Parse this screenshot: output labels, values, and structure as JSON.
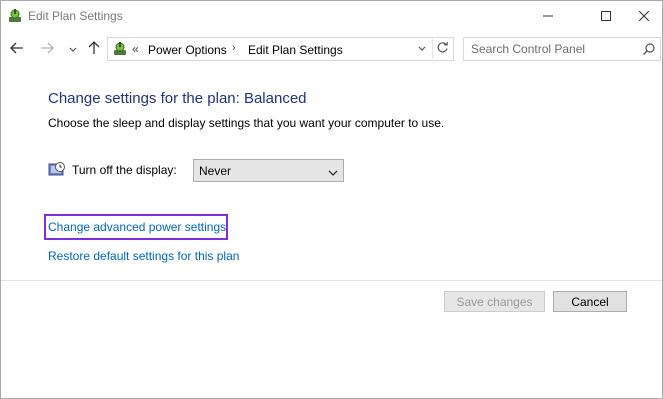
{
  "window": {
    "title": "Edit Plan Settings"
  },
  "nav": {
    "address_lead": "«",
    "breadcrumb": [
      "Power Options",
      "Edit Plan Settings"
    ],
    "breadcrumb_sep": "›",
    "search_placeholder": "Search Control Panel"
  },
  "content": {
    "heading": "Change settings for the plan: Balanced",
    "subtitle": "Choose the sleep and display settings that you want your computer to use.",
    "display_label": "Turn off the display:",
    "display_value": "Never",
    "advanced_link": "Change advanced power settings",
    "restore_link": "Restore default settings for this plan"
  },
  "buttons": {
    "save": "Save changes",
    "cancel": "Cancel"
  },
  "colors": {
    "heading": "#1e3287",
    "link": "#0066cc",
    "highlight_border": "#7b2fe0"
  },
  "icons": {
    "app": "power-options-icon",
    "back": "back-arrow-icon",
    "forward": "forward-arrow-icon",
    "recent": "chevron-down-icon",
    "up": "up-arrow-icon",
    "refresh": "refresh-icon",
    "search": "search-icon",
    "display": "display-timer-icon"
  }
}
